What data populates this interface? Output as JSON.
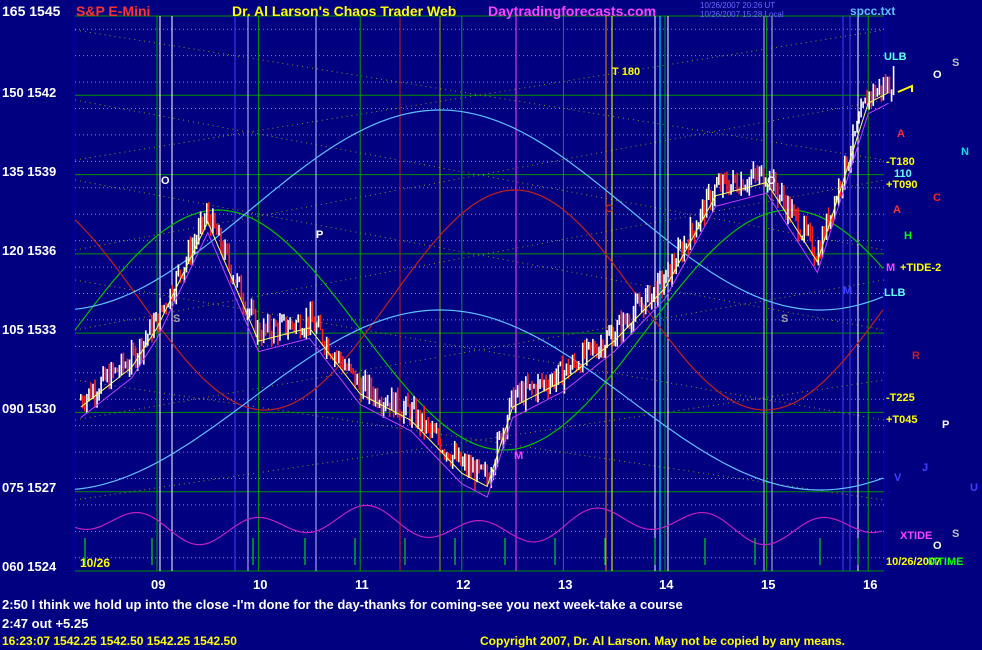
{
  "header": {
    "title": "S&P E-Mini",
    "center_title": "Dr. Al Larson's Chaos Trader Web",
    "site": "Daytradingforecasts.com",
    "file": "spcc.txt",
    "timestamp_1": "10/26/2007 20:26 UT",
    "timestamp_2": "10/26/2007 15:28 Local"
  },
  "colors": {
    "background": "#000080",
    "title_red": "#ff3030",
    "title_yellow": "#ffff00",
    "site_magenta": "#ff40ff",
    "file_cyan": "#60c0ff"
  },
  "chart_data": {
    "type": "bar",
    "title": "S&P E-Mini",
    "y_labels": [
      "165 1545",
      "150 1542",
      "135 1539",
      "120 1536",
      "105 1533",
      "090 1530",
      "075 1527",
      "060 1524"
    ],
    "ylim": [
      1524,
      1545
    ],
    "x_labels": [
      "09",
      "10",
      "11",
      "12",
      "13",
      "14",
      "15",
      "16"
    ],
    "date_label": "10/26",
    "price_series_hourly": [
      {
        "x": "08:15",
        "y": 1530.5
      },
      {
        "x": "08:45",
        "y": 1532.0
      },
      {
        "x": "09:00",
        "y": 1533.5
      },
      {
        "x": "09:30",
        "y": 1537.5
      },
      {
        "x": "10:00",
        "y": 1533.0
      },
      {
        "x": "10:30",
        "y": 1533.5
      },
      {
        "x": "11:00",
        "y": 1531.0
      },
      {
        "x": "11:30",
        "y": 1530.0
      },
      {
        "x": "12:00",
        "y": 1528.0
      },
      {
        "x": "12:15",
        "y": 1527.5
      },
      {
        "x": "12:30",
        "y": 1530.5
      },
      {
        "x": "13:00",
        "y": 1531.5
      },
      {
        "x": "13:30",
        "y": 1533.0
      },
      {
        "x": "14:00",
        "y": 1535.0
      },
      {
        "x": "14:30",
        "y": 1538.5
      },
      {
        "x": "15:00",
        "y": 1539.0
      },
      {
        "x": "15:30",
        "y": 1536.0
      },
      {
        "x": "16:00",
        "y": 1542.0
      },
      {
        "x": "16:15",
        "y": 1542.5
      }
    ],
    "grid": true,
    "right_labels": [
      "ULB",
      "-T180",
      "110",
      "+T090",
      "+TIDE-2",
      "LLB",
      "-T225",
      "+T045",
      "XTIDE",
      "10/26/2007",
      "MTIME"
    ],
    "planet_letters": [
      "S",
      "N",
      "C",
      "H",
      "R",
      "P",
      "U",
      "V",
      "J",
      "O",
      "A",
      "M",
      "S"
    ],
    "chart_letters": [
      "O",
      "P",
      "S",
      "M",
      "T 180",
      "C",
      "O",
      "S",
      "M"
    ]
  },
  "footer": {
    "comment": "2:50 I think we hold up into the close -I'm done for the day-thanks for coming-see you next week-take a course",
    "out_note": "2:47 out +5.25",
    "quote": "16:23:07  1542.25  1542.50  1542.25  1542.50",
    "copyright": "Copyright 2007, Dr. Al Larson. May not be copied by any means."
  }
}
